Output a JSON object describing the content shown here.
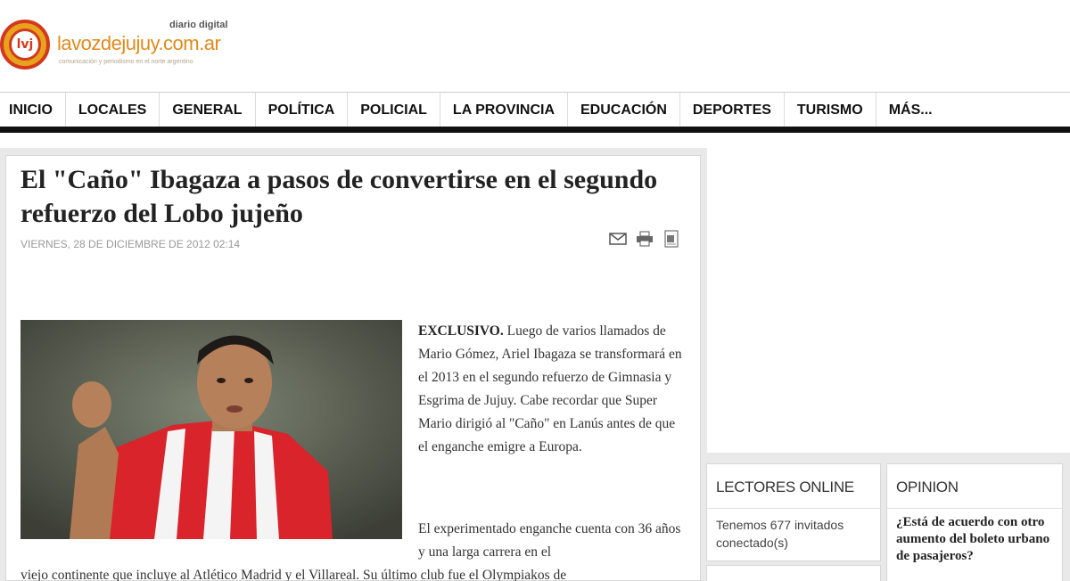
{
  "site": {
    "brand_small": "diario digital",
    "domain": "lavozdejujuy.com.ar",
    "tagline": "comunicación y periodismo en el norte argentino",
    "logo_letters": "lvj"
  },
  "nav": {
    "items": [
      "INICIO",
      "LOCALES",
      "GENERAL",
      "POLÍTICA",
      "POLICIAL",
      "LA PROVINCIA",
      "EDUCACIÓN",
      "DEPORTES",
      "TURISMO",
      "MÁS..."
    ]
  },
  "article": {
    "title": "El \"Caño\" Ibagaza a pasos de convertirse en el segundo refuerzo del Lobo jujeño",
    "date": "VIERNES, 28 DE DICIEMBRE DE 2012 02:14",
    "lead_bold": "EXCLUSIVO.",
    "lead_text": " Luego de varios llamados de Mario Gómez, Ariel Ibagaza se transformará en el 2013 en el segundo refuerzo de Gimnasia y Esgrima de Jujuy. Cabe recordar que Super Mario dirigió al \"Caño\" en Lanús antes de que el enganche emigre a Europa.",
    "para2": "El experimentado enganche cuenta con 36 años y una larga carrera en el",
    "para3": "viejo continente que incluye al Atlético Madrid y el Villareal. Su último club fue el Olympiakos de",
    "tools": [
      "email-icon",
      "print-icon",
      "pdf-icon"
    ]
  },
  "sidebar": {
    "lectores": {
      "heading": "LECTORES ONLINE",
      "text": "Tenemos 677 invitados conectado(s)"
    },
    "opinion": {
      "heading": "OPINION",
      "question": "¿Está de acuerdo con otro aumento del boleto urbano de pasajeros?"
    }
  },
  "colors": {
    "logo_orange": "#e08a1c",
    "logo_red": "#d2391e",
    "nav_bar": "#111111"
  }
}
